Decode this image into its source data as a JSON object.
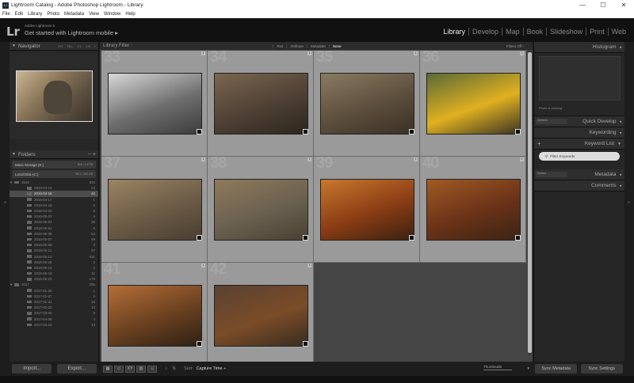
{
  "window": {
    "title": "Lightroom Catalog - Adobe Photoshop Lightroom - Library",
    "controls": [
      "—",
      "☐",
      "✕"
    ]
  },
  "menu": [
    "File",
    "Edit",
    "Library",
    "Photo",
    "Metadata",
    "View",
    "Window",
    "Help"
  ],
  "identity": {
    "logo": "Lr",
    "product": "Adobe Lightroom 6",
    "tagline": "Get started with Lightroom mobile",
    "arrow": "▸"
  },
  "modules": [
    "Library",
    "Develop",
    "Map",
    "Book",
    "Slideshow",
    "Print",
    "Web"
  ],
  "active_module": "Library",
  "navigator": {
    "title": "Navigator",
    "options": "FIT FILL 1:1 1:8 ÷"
  },
  "folders": {
    "title": "Folders",
    "volumes": [
      {
        "name": "Mass Storage (K:)",
        "stat": "824 / 1.8 TB"
      },
      {
        "name": "Local Disk (C:)",
        "stat": "98.1 / 232 GB"
      }
    ],
    "rows": [
      {
        "name": "2016",
        "count": "923"
      },
      {
        "name": "2016-04-15",
        "count": "24"
      },
      {
        "name": "2016-04-16",
        "count": "42"
      },
      {
        "name": "2016-04-17",
        "count": "1"
      },
      {
        "name": "2016-04-18",
        "count": "6"
      },
      {
        "name": "2016-04-22",
        "count": "6"
      },
      {
        "name": "2016-05-02",
        "count": "6"
      },
      {
        "name": "2016-05-03",
        "count": "38"
      },
      {
        "name": "2016-05-04",
        "count": "5"
      },
      {
        "name": "2016-05-05",
        "count": "63"
      },
      {
        "name": "2016-05-07",
        "count": "48"
      },
      {
        "name": "2016-05-09",
        "count": "3"
      },
      {
        "name": "2016-05-11",
        "count": "57"
      },
      {
        "name": "2016-05-13",
        "count": "431"
      },
      {
        "name": "2016-05-15",
        "count": "2"
      },
      {
        "name": "2016-05-16",
        "count": "1"
      },
      {
        "name": "2016-05-18",
        "count": "11"
      },
      {
        "name": "2016-05-20",
        "count": "178"
      },
      {
        "name": "2017",
        "count": "256"
      },
      {
        "name": "2017-01-26",
        "count": "1"
      },
      {
        "name": "2017-01-27",
        "count": "2"
      },
      {
        "name": "2017-01-31",
        "count": "19"
      },
      {
        "name": "2017-02-22",
        "count": "13"
      },
      {
        "name": "2017-03-02",
        "count": "9"
      },
      {
        "name": "2017-04-06",
        "count": "4"
      },
      {
        "name": "2017-04-10",
        "count": "13"
      }
    ]
  },
  "buttons": {
    "import": "Import...",
    "export": "Export...",
    "sync_metadata": "Sync Metadata",
    "sync_settings": "Sync Settings"
  },
  "filter_bar": {
    "label": "Library Filter :",
    "options": [
      "Text",
      "Attribute",
      "Metadata",
      "None"
    ],
    "active": "None",
    "filters_off": "Filters Off ÷"
  },
  "grid": [
    {
      "num": "33",
      "colors": [
        "#d8d8d8",
        "#6e6e6e",
        "#3c3c3c"
      ]
    },
    {
      "num": "34",
      "colors": [
        "#7a6650",
        "#4e4034",
        "#2e261e"
      ]
    },
    {
      "num": "35",
      "colors": [
        "#8a7a62",
        "#5c4e3c",
        "#3a3026"
      ]
    },
    {
      "num": "36",
      "colors": [
        "#5a6a38",
        "#e0b020",
        "#3c3424"
      ]
    },
    {
      "num": "37",
      "colors": [
        "#9a8462",
        "#6a5a46",
        "#4a3e30"
      ]
    },
    {
      "num": "38",
      "colors": [
        "#8e7a5a",
        "#6a6050",
        "#4a4032"
      ]
    },
    {
      "num": "39",
      "colors": [
        "#c8782e",
        "#8a3c14",
        "#3a2210"
      ]
    },
    {
      "num": "40",
      "colors": [
        "#a05a24",
        "#6a3218",
        "#3a2414"
      ]
    },
    {
      "num": "41",
      "colors": [
        "#b46e38",
        "#6a4020",
        "#2e2014"
      ]
    },
    {
      "num": "42",
      "colors": [
        "#5a4232",
        "#7a4c28",
        "#3a2c20"
      ]
    }
  ],
  "toolbar": {
    "sort_label": "Sort:",
    "sort_value": "Capture Time ÷",
    "thumbnails": "Thumbnails"
  },
  "right": {
    "histogram": "Histogram",
    "photo_missing": "Photo is missing",
    "quick_develop": "Quick Develop",
    "quick_develop_preset": "Defaults",
    "keywording": "Keywording",
    "keyword_list": "Keyword List",
    "filter_keywords": "Filter Keywords",
    "metadata": "Metadata",
    "metadata_preset": "Default",
    "comments": "Comments"
  }
}
